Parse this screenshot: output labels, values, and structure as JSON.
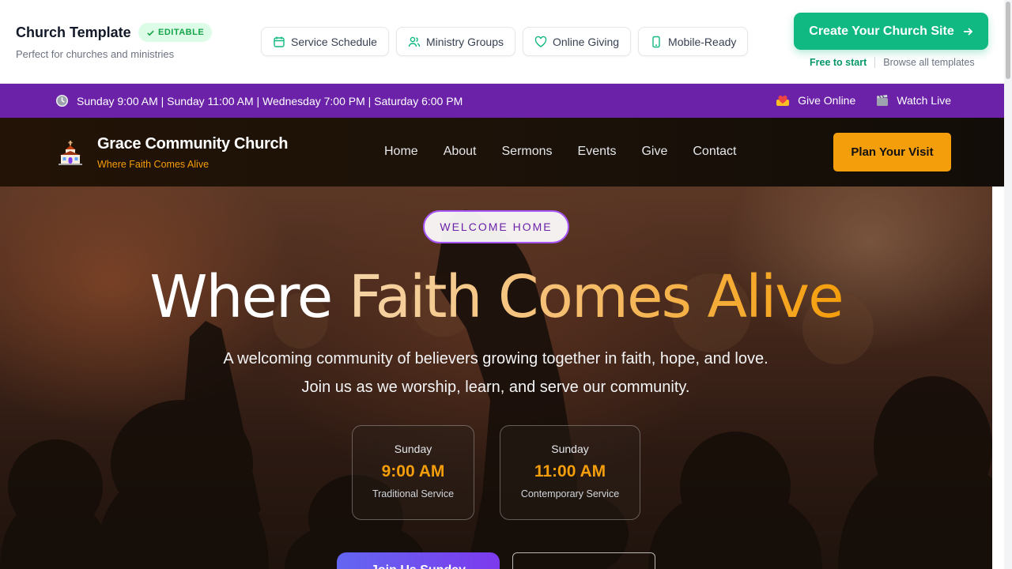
{
  "template_bar": {
    "title": "Church Template",
    "badge": "EDITABLE",
    "subtitle": "Perfect for churches and ministries",
    "features": [
      {
        "label": "Service Schedule",
        "icon": "calendar-icon"
      },
      {
        "label": "Ministry Groups",
        "icon": "users-icon"
      },
      {
        "label": "Online Giving",
        "icon": "heart-icon"
      },
      {
        "label": "Mobile-Ready",
        "icon": "phone-icon"
      }
    ],
    "cta_label": "Create Your Church Site",
    "free_label": "Free to start",
    "browse_label": "Browse all templates"
  },
  "info_bar": {
    "service_times": "Sunday 9:00 AM | Sunday 11:00 AM | Wednesday 7:00 PM | Saturday 6:00 PM",
    "give_label": "Give Online",
    "watch_label": "Watch Live"
  },
  "site_nav": {
    "church_name": "Grace Community Church",
    "tagline": "Where Faith Comes Alive",
    "menu": [
      "Home",
      "About",
      "Sermons",
      "Events",
      "Give",
      "Contact"
    ],
    "visit_label": "Plan Your Visit"
  },
  "hero": {
    "eyebrow": "WELCOME HOME",
    "headline_white": "Where",
    "headline_gold": "Faith Comes Alive",
    "lead": "A welcoming community of believers growing together in faith, hope, and love. Join us as we worship, learn, and serve our community.",
    "services": [
      {
        "day": "Sunday",
        "time": "9:00 AM",
        "type": "Traditional Service"
      },
      {
        "day": "Sunday",
        "time": "11:00 AM",
        "type": "Contemporary Service"
      }
    ],
    "join_label": "Join Us Sunday"
  },
  "colors": {
    "accent_green": "#10b981",
    "brand_purple": "#6b21a8",
    "gold": "#f59e0b"
  }
}
